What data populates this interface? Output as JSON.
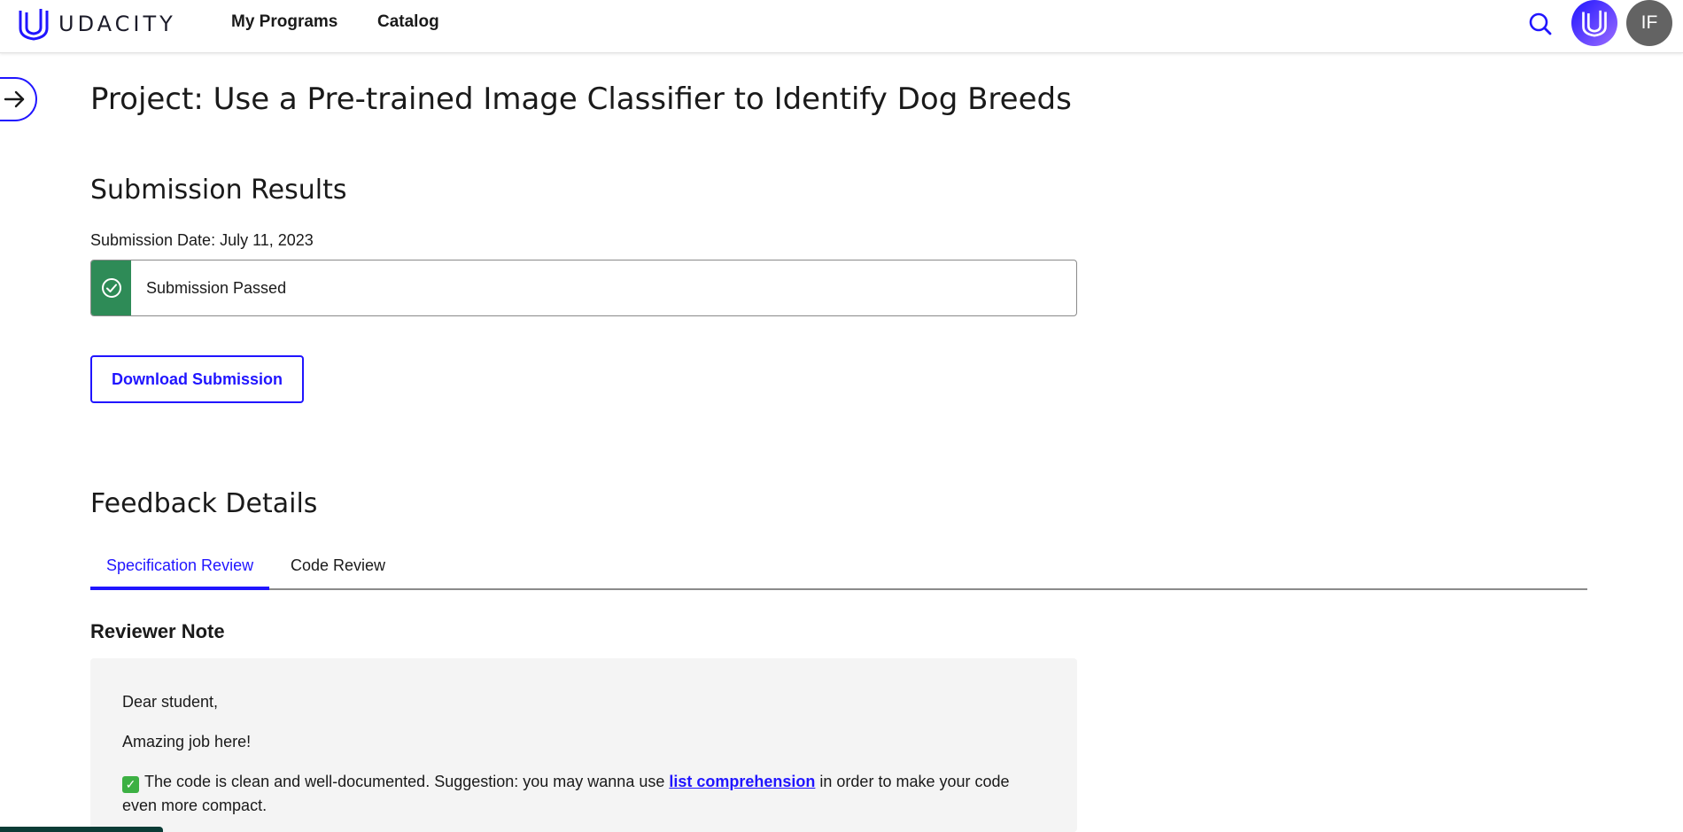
{
  "header": {
    "logo_text": "UDACITY",
    "nav": [
      {
        "label": "My Programs"
      },
      {
        "label": "Catalog"
      }
    ],
    "user_initials": "IF"
  },
  "page": {
    "title": "Project: Use a Pre-trained Image Classifier to Identify Dog Breeds"
  },
  "submission": {
    "heading": "Submission Results",
    "date_text": "Submission Date: July 11, 2023",
    "status": "Submission Passed",
    "download_label": "Download Submission"
  },
  "feedback": {
    "heading": "Feedback Details",
    "tabs": [
      {
        "label": "Specification Review",
        "active": true
      },
      {
        "label": "Code Review",
        "active": false
      }
    ],
    "reviewer_heading": "Reviewer Note",
    "note": {
      "greeting": "Dear student,",
      "line1": "Amazing job here!",
      "line2_before": "The code is clean and well-documented. Suggestion: you may wanna use ",
      "line2_link": "list comprehension",
      "line2_after": " in order to make your code even more compact."
    }
  },
  "colors": {
    "accent": "#2015ff",
    "success": "#2e8b57",
    "note_bg": "#f4f4f4"
  },
  "icons": [
    "udacity-logo-icon",
    "search-icon",
    "arrow-right-icon",
    "check-circle-icon",
    "check-mark-emoji-icon"
  ]
}
